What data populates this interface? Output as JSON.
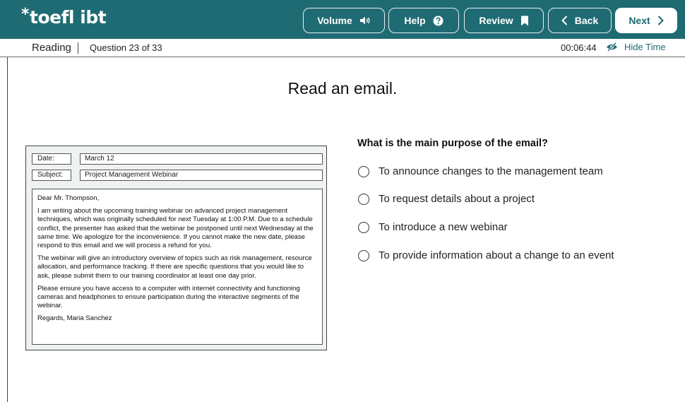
{
  "header": {
    "logo_star": "*",
    "logo_text": "toefl ibt",
    "buttons": {
      "volume": "Volume",
      "help": "Help",
      "review": "Review",
      "back": "Back",
      "next": "Next"
    }
  },
  "subheader": {
    "section": "Reading",
    "question_label": "Question 23 of 33",
    "timer": "00:06:44",
    "hide_time": "Hide Time"
  },
  "main": {
    "title": "Read an email."
  },
  "email": {
    "date_label": "Date:",
    "date_value": "March 12",
    "subject_label": "Subject:",
    "subject_value": "Project Management Webinar",
    "greeting": "Dear Mr. Thompson,",
    "paragraphs": [
      "I am writing about the upcoming training webinar on advanced project management techniques, which was originally scheduled for next Tuesday at 1:00 P.M. Due to a schedule conflict, the presenter has asked that the webinar be postponed until next Wednesday at the same time. We apologize for the inconvenience. If you cannot make the new date, please respond to this email and we will process a refund for you.",
      "The webinar will give an introductory overview of topics such as risk management, resource allocation, and performance tracking. If there are specific questions that you would like to ask, please submit them to our training coordinator at least one day prior.",
      "Please ensure you have access to a computer with internet connectivity and functioning cameras and headphones to ensure participation during the interactive segments of the webinar."
    ],
    "signoff": "Regards, Maria Sanchez"
  },
  "question": {
    "text": "What is the main purpose of the email?",
    "options": [
      "To announce changes to the management team",
      "To request details about a project",
      "To introduce a new webinar",
      "To provide information about a change to an event"
    ]
  },
  "colors": {
    "brand": "#1f6b73",
    "email_background": "#eef2f1"
  }
}
